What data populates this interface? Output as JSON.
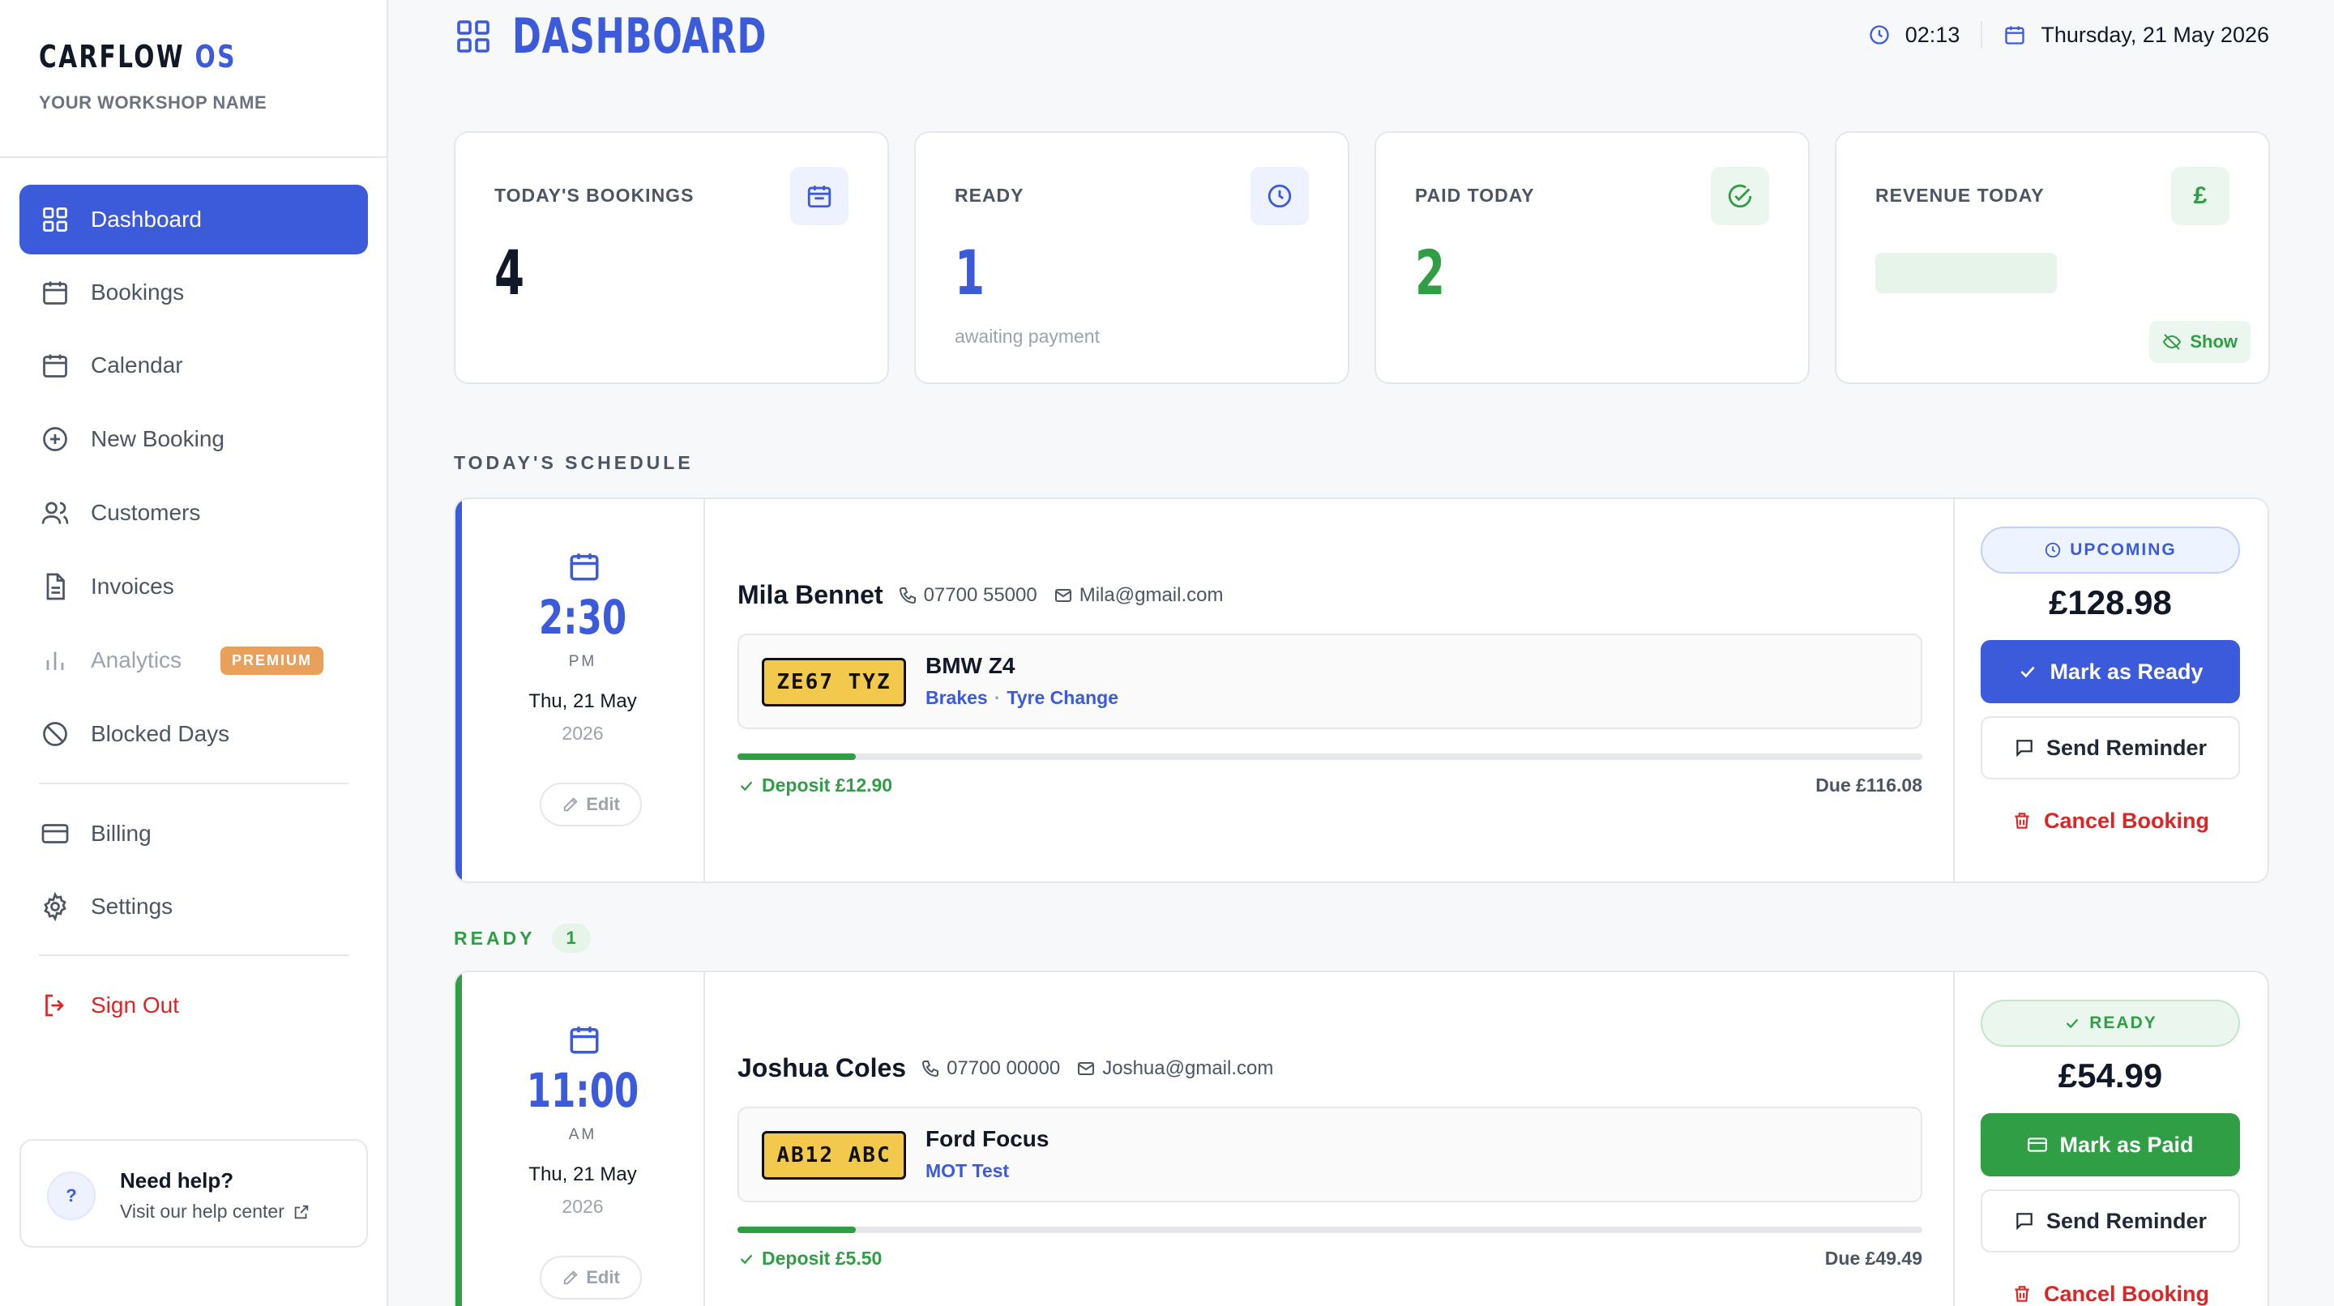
{
  "sidebar": {
    "brand": {
      "name": "CARFLOW",
      "suffix": "OS"
    },
    "workshop_name": "YOUR WORKSHOP NAME",
    "items": [
      {
        "label": "Dashboard",
        "icon": "grid-icon"
      },
      {
        "label": "Bookings",
        "icon": "calendar-icon"
      },
      {
        "label": "Calendar",
        "icon": "calendar-icon"
      },
      {
        "label": "New Booking",
        "icon": "plus-circle-icon"
      },
      {
        "label": "Customers",
        "icon": "users-icon"
      },
      {
        "label": "Invoices",
        "icon": "document-icon"
      },
      {
        "label": "Analytics",
        "icon": "bar-chart-icon",
        "badge": "PREMIUM"
      },
      {
        "label": "Blocked Days",
        "icon": "ban-icon"
      },
      {
        "label": "Billing",
        "icon": "credit-card-icon"
      },
      {
        "label": "Settings",
        "icon": "gear-icon"
      },
      {
        "label": "Sign Out",
        "icon": "logout-icon"
      }
    ],
    "help": {
      "icon_text": "?",
      "title": "Need help?",
      "link": "Visit our help center"
    }
  },
  "header": {
    "title": "DASHBOARD",
    "time": "02:13",
    "date": "Thursday, 21 May 2026"
  },
  "stats": [
    {
      "label": "TODAY'S BOOKINGS",
      "value": "4",
      "icon": "calendar-icon"
    },
    {
      "label": "READY",
      "value": "1",
      "sub": "awaiting payment",
      "icon": "clock-icon"
    },
    {
      "label": "PAID TODAY",
      "value": "2",
      "icon": "check-circle-icon"
    },
    {
      "label": "REVENUE TODAY",
      "icon_text": "£",
      "show_label": "Show"
    }
  ],
  "sections": {
    "schedule": "TODAY'S SCHEDULE",
    "ready": {
      "label": "READY",
      "count": "1"
    }
  },
  "bookings": [
    {
      "time": "2:30",
      "ampm": "PM",
      "date": "Thu, 21 May",
      "year": "2026",
      "edit": "Edit",
      "customer": "Mila Bennet",
      "phone": "07700 55000",
      "email": "Mila@gmail.com",
      "plate": "ZE67 TYZ",
      "vehicle": "BMW Z4",
      "services": [
        "Brakes",
        "Tyre Change"
      ],
      "deposit": "Deposit £12.90",
      "due": "Due £116.08",
      "deposit_fraction": 0.1,
      "status": "UPCOMING",
      "amount": "£128.98",
      "primary_action": "Mark as Ready",
      "secondary_action": "Send Reminder",
      "cancel_action": "Cancel Booking"
    },
    {
      "time": "11:00",
      "ampm": "AM",
      "date": "Thu, 21 May",
      "year": "2026",
      "edit": "Edit",
      "customer": "Joshua Coles",
      "phone": "07700 00000",
      "email": "Joshua@gmail.com",
      "plate": "AB12 ABC",
      "vehicle": "Ford Focus",
      "services": [
        "MOT Test"
      ],
      "deposit": "Deposit £5.50",
      "due": "Due £49.49",
      "deposit_fraction": 0.1,
      "status": "READY",
      "amount": "£54.99",
      "primary_action": "Mark as Paid",
      "secondary_action": "Send Reminder",
      "cancel_action": "Cancel Booking"
    }
  ],
  "colors": {
    "accent": "#3b5bdb",
    "success": "#2f9e44",
    "danger": "#dc2626",
    "premium": "#e8a05a"
  }
}
